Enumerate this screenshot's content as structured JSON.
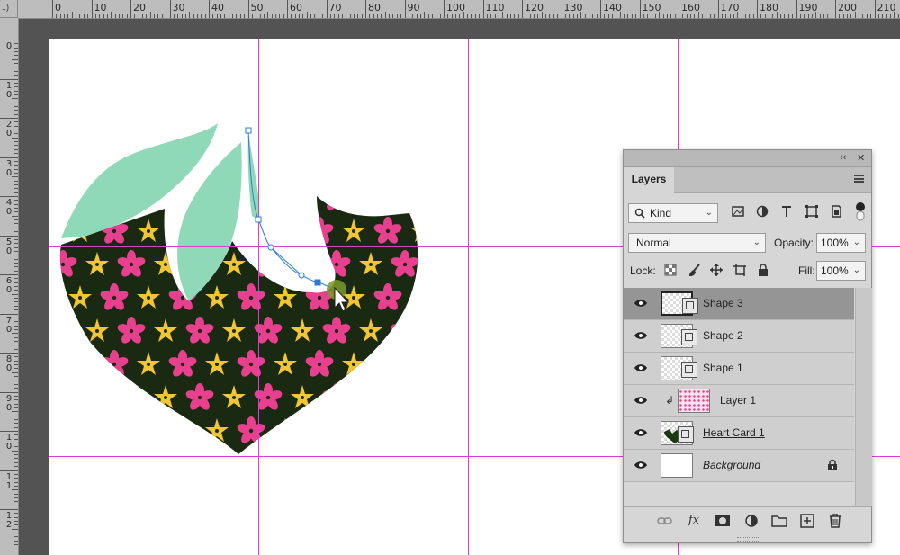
{
  "ruler": {
    "corner": "..)",
    "top_labels": [
      "0",
      "10",
      "20",
      "30",
      "40",
      "50",
      "60",
      "70",
      "80",
      "90",
      "100",
      "110",
      "120",
      "130",
      "140",
      "150",
      "160",
      "170",
      "180",
      "190",
      "200",
      "210"
    ],
    "left_labels": [
      [
        "0"
      ],
      [
        "1",
        "0"
      ],
      [
        "2",
        "0"
      ],
      [
        "3",
        "0"
      ],
      [
        "4",
        "0"
      ],
      [
        "5",
        "0"
      ],
      [
        "6",
        "0"
      ],
      [
        "7",
        "0"
      ],
      [
        "8",
        "0"
      ],
      [
        "9",
        "0"
      ],
      [
        "1",
        "0"
      ],
      [
        "1",
        "1"
      ],
      [
        "1",
        "2"
      ]
    ]
  },
  "layers_panel": {
    "collapse_glyph": "‹‹",
    "close_glyph": "✕",
    "tab_label": "Layers",
    "filter_kind": "Kind",
    "blend_mode": "Normal",
    "opacity_label": "Opacity:",
    "opacity_value": "100%",
    "lock_label": "Lock:",
    "fill_label": "Fill:",
    "fill_value": "100%",
    "filter_icons": [
      "image-filter-icon",
      "adjustment-filter-icon",
      "type-filter-icon",
      "shape-filter-icon",
      "smart-object-filter-icon",
      "filter-toggle-icon"
    ],
    "lock_icons": [
      "lock-transparent-icon",
      "lock-image-icon",
      "lock-position-icon",
      "lock-artboard-icon",
      "lock-all-icon"
    ],
    "layers": [
      {
        "name": "Shape 3",
        "selected": true,
        "type": "shape"
      },
      {
        "name": "Shape 2",
        "selected": false,
        "type": "shape"
      },
      {
        "name": "Shape 1",
        "selected": false,
        "type": "shape"
      },
      {
        "name": "Layer 1",
        "selected": false,
        "type": "pattern",
        "clipped": true
      },
      {
        "name": "Heart Card 1",
        "selected": false,
        "type": "heart",
        "underlined": true
      },
      {
        "name": "Background",
        "selected": false,
        "type": "background",
        "italic": true,
        "locked": true
      }
    ],
    "bottom_icons": [
      "link-layers-icon",
      "fx-icon",
      "add-mask-icon",
      "adjustment-layer-icon",
      "new-group-icon",
      "new-layer-icon",
      "delete-icon"
    ],
    "fx_text": "fx"
  },
  "colors": {
    "workspace": "#535353",
    "guide": "#e23ad8",
    "leaf": "#8fd8b8",
    "heart_bg": "#1a2a12",
    "flower_pink": "#e8408e",
    "flower_yellow": "#f2c532",
    "path": "#2b7bd4"
  }
}
